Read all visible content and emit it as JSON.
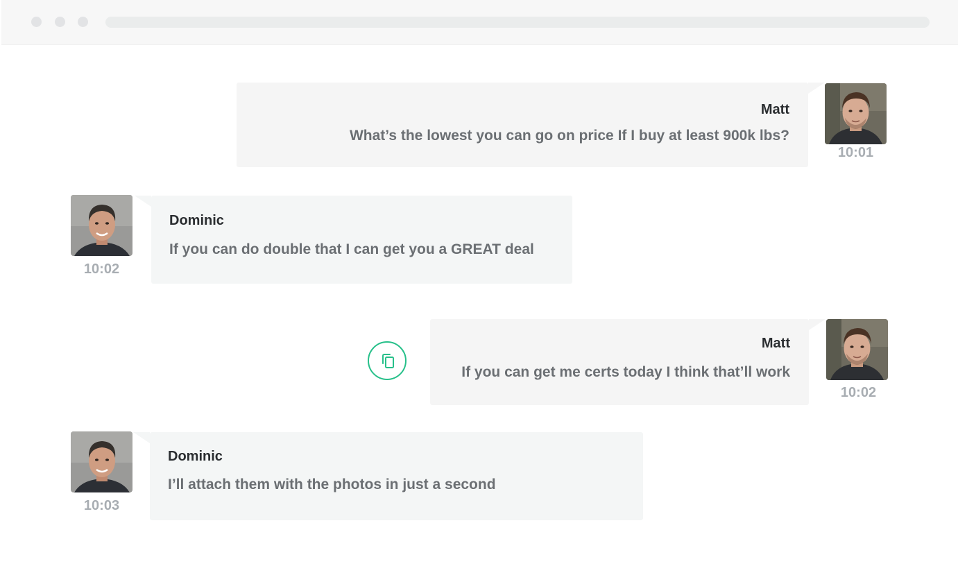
{
  "browser": {
    "dots": [
      "window-dot",
      "window-dot",
      "window-dot"
    ]
  },
  "messages": [
    {
      "sender": "Matt",
      "text": "What’s the lowest you can go on price If I buy at least 900k lbs?",
      "time": "10:01",
      "side": "sent"
    },
    {
      "sender": "Dominic",
      "text": "If you can do double that I can get you a GREAT deal",
      "time": "10:02",
      "side": "received"
    },
    {
      "sender": "Matt",
      "text": "If you can get me certs today I think that’ll work",
      "time": "10:02",
      "side": "sent"
    },
    {
      "sender": "Dominic",
      "text": "I’ll attach them with the photos in just a second",
      "time": "10:03",
      "side": "received"
    }
  ],
  "actions": {
    "copy_icon": "copy-icon"
  },
  "colors": {
    "accent": "#27c08a",
    "sent_bubble": "#f5f5f5",
    "received_bubble": "#f4f6f6",
    "sender_text": "#2a2d30",
    "message_text": "#6b6f73",
    "timestamp_text": "#a8adb2"
  }
}
